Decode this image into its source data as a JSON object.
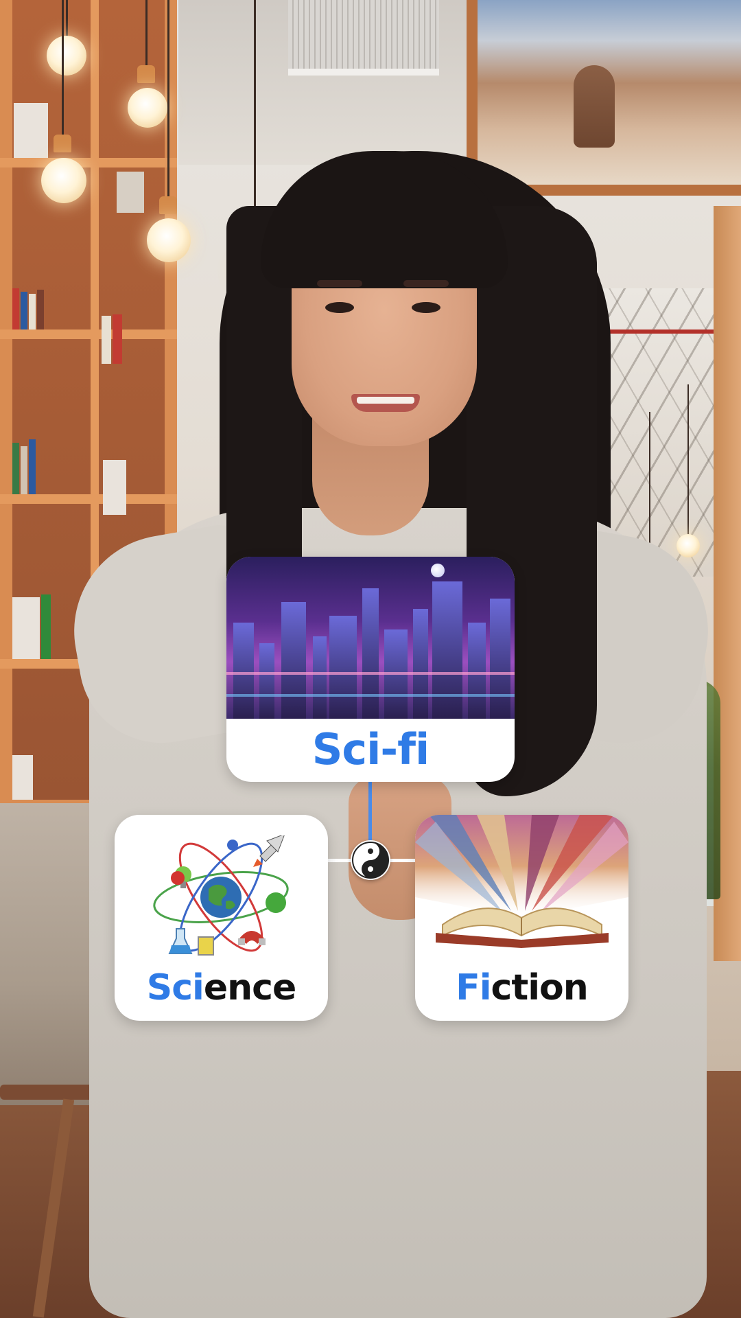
{
  "scene": {
    "setting": "cafe-library",
    "presenter": "woman-in-beige-dress"
  },
  "cards": {
    "top": {
      "label_highlight": "Sci-fi",
      "label_rest": "",
      "image_icon": "futuristic-city-image"
    },
    "left": {
      "label_highlight": "Sci",
      "label_rest": "ence",
      "image_icon": "atom-science-icon"
    },
    "right": {
      "label_highlight": "Fi",
      "label_rest": "ction",
      "image_icon": "open-book-icon"
    }
  },
  "connector": {
    "icon": "yin-yang-icon"
  },
  "colors": {
    "accent": "#2f7be6",
    "text": "#111111",
    "card": "#ffffff"
  }
}
